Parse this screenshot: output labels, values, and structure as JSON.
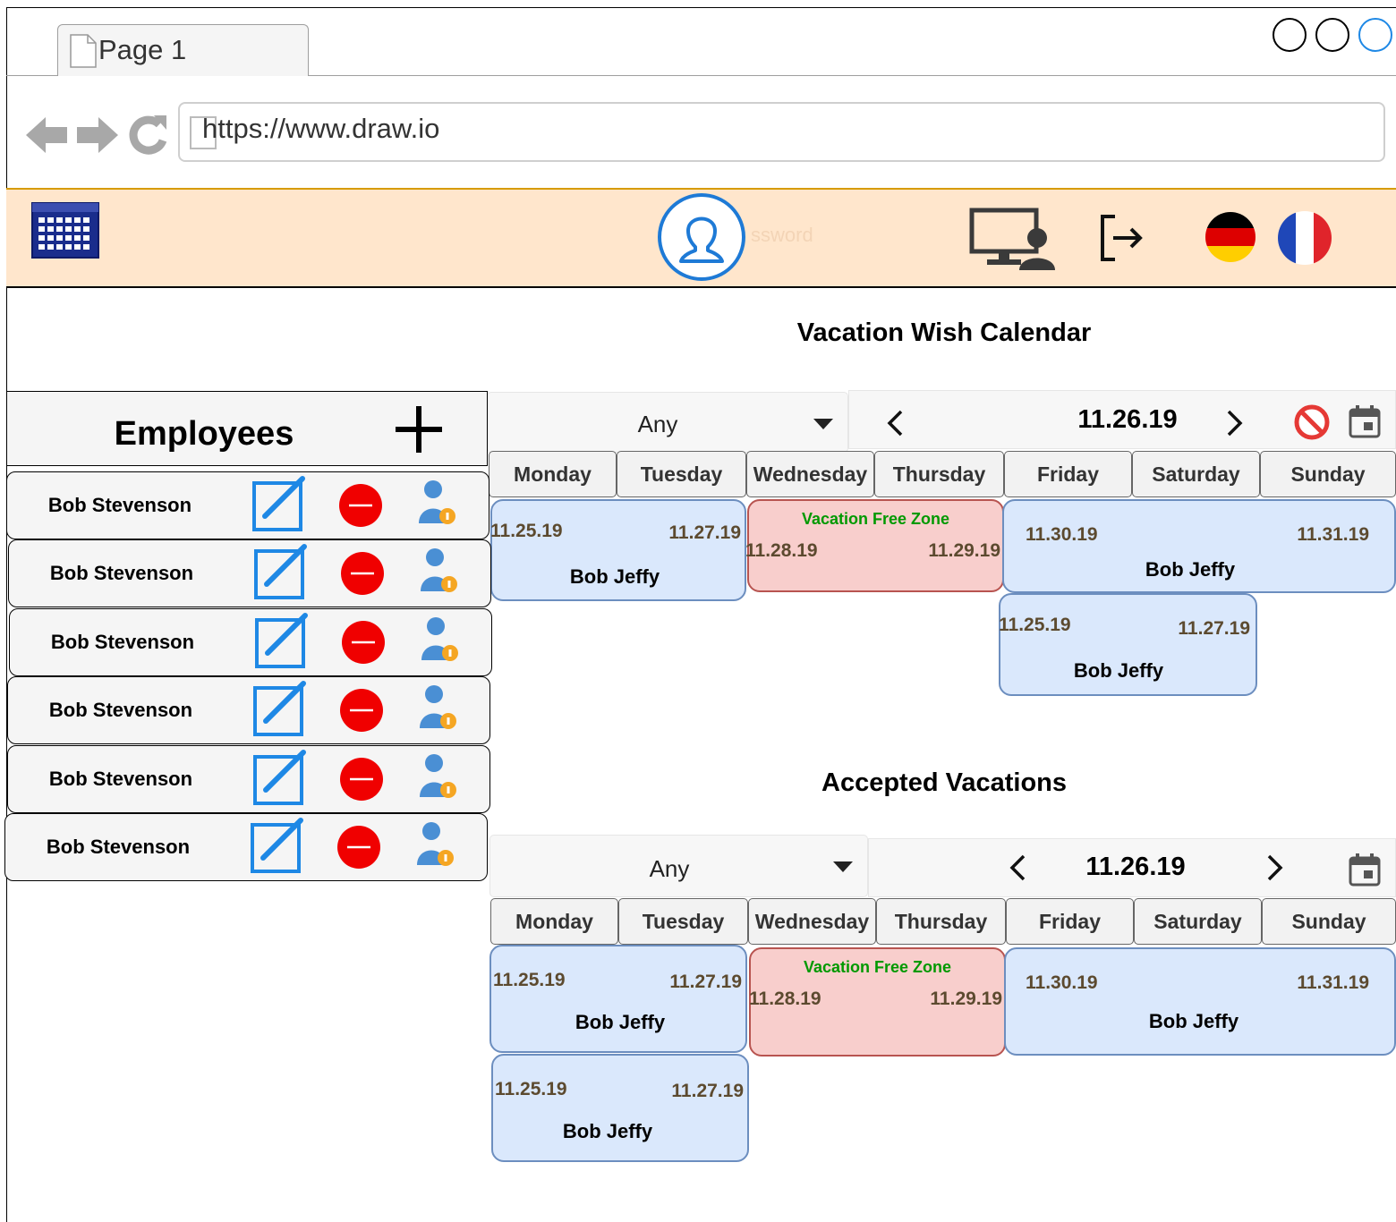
{
  "browser": {
    "tab_label": "Page 1",
    "url": "https://www.draw.io"
  },
  "header": {
    "password_hint": "ssword"
  },
  "wish_calendar": {
    "title": "Vacation Wish Calendar",
    "filter": "Any",
    "date": "11.26.19",
    "days": [
      "Monday",
      "Tuesday",
      "Wednesday",
      "Thursday",
      "Friday",
      "Saturday",
      "Sunday"
    ],
    "events": [
      {
        "start": "11.25.19",
        "end": "11.27.19",
        "name": "Bob Jeffy"
      },
      {
        "label": "Vacation Free Zone",
        "start": "11.28.19",
        "end": "11.29.19"
      },
      {
        "start": "11.30.19",
        "end": "11.31.19",
        "name": "Bob Jeffy"
      },
      {
        "start": "11.25.19",
        "end": "11.27.19",
        "name": "Bob Jeffy"
      }
    ]
  },
  "accepted": {
    "title": "Accepted Vacations",
    "filter": "Any",
    "date": "11.26.19",
    "days": [
      "Monday",
      "Tuesday",
      "Wednesday",
      "Thursday",
      "Friday",
      "Saturday",
      "Sunday"
    ],
    "events": [
      {
        "start": "11.25.19",
        "end": "11.27.19",
        "name": "Bob Jeffy"
      },
      {
        "label": "Vacation Free Zone",
        "start": "11.28.19",
        "end": "11.29.19"
      },
      {
        "start": "11.30.19",
        "end": "11.31.19",
        "name": "Bob Jeffy"
      },
      {
        "start": "11.25.19",
        "end": "11.27.19",
        "name": "Bob Jeffy"
      }
    ]
  },
  "employees": {
    "title": "Employees",
    "rows": [
      "Bob Stevenson",
      "Bob Stevenson",
      "Bob Stevenson",
      "Bob Stevenson",
      "Bob Stevenson",
      "Bob Stevenson"
    ]
  }
}
